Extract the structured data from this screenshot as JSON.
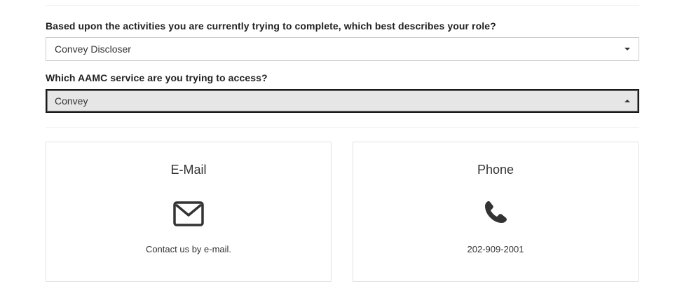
{
  "form": {
    "role_question": "Based upon the activities you are currently trying to complete, which best describes your role?",
    "role_value": "Convey Discloser",
    "service_question": "Which AAMC service are you trying to access?",
    "service_value": "Convey"
  },
  "contact": {
    "email": {
      "title": "E-Mail",
      "icon": "envelope-icon",
      "text": "Contact us by e-mail."
    },
    "phone": {
      "title": "Phone",
      "icon": "phone-icon",
      "text": "202-909-2001"
    }
  },
  "colors": {
    "text": "#333333",
    "border": "#cccccc",
    "active_select_bg": "#e6e6e6",
    "active_select_border": "#1a1a1a"
  }
}
